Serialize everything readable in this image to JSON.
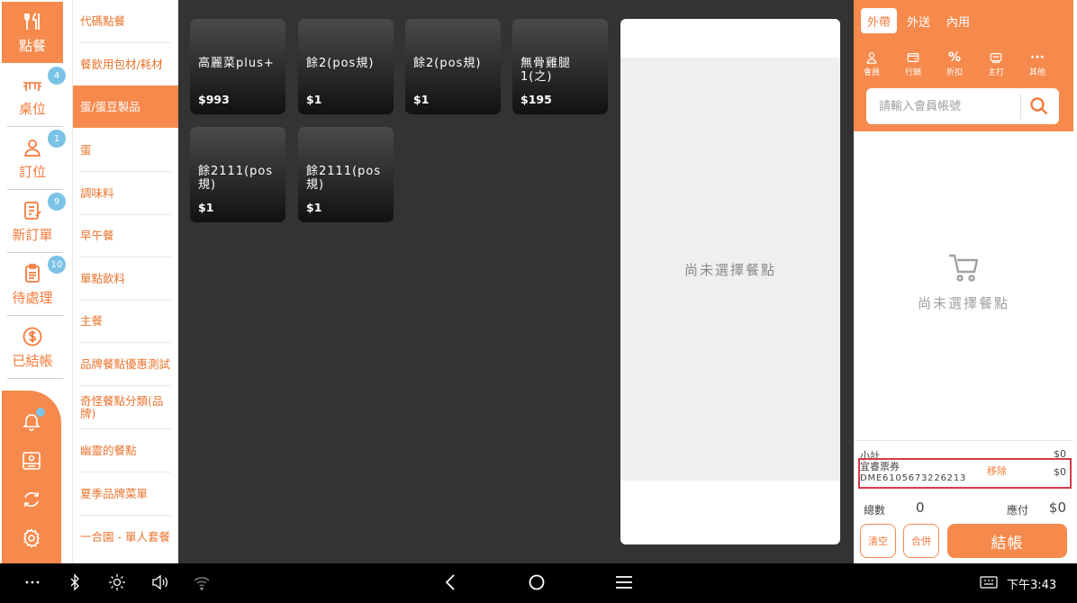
{
  "nav": {
    "items": [
      {
        "label": "點餐",
        "icon": "utensils-icon",
        "badge": ""
      },
      {
        "label": "桌位",
        "icon": "table-icon",
        "badge": "4"
      },
      {
        "label": "訂位",
        "icon": "user-icon",
        "badge": "1"
      },
      {
        "label": "新訂單",
        "icon": "edit-list-icon",
        "badge": "9"
      },
      {
        "label": "待處理",
        "icon": "clipboard-icon",
        "badge": "10"
      },
      {
        "label": "已結帳",
        "icon": "dollar-icon",
        "badge": ""
      }
    ],
    "tools": [
      "bell-icon",
      "cash-drawer-icon",
      "refresh-icon",
      "gear-icon"
    ]
  },
  "categories": [
    "代碼點餐",
    "餐飲用包材/耗材",
    "蛋/蛋豆製品",
    "蛋",
    "調味料",
    "早午餐",
    "單點飲料",
    "主餐",
    "品牌餐點優惠測試",
    "奇怪餐點分類(品牌)",
    "幽靈的餐點",
    "夏季品牌菜單",
    "一合園 - 單人套餐"
  ],
  "active_category": "蛋/蛋豆製品",
  "products": [
    {
      "name": "高麗菜plus+",
      "price": "$993"
    },
    {
      "name": "餘2(pos規)",
      "price": "$1"
    },
    {
      "name": "餘2(pos規)",
      "price": "$1"
    },
    {
      "name": "無骨雞腿1(之)",
      "price": "$195"
    },
    {
      "name": "餘2111(pos規)",
      "price": "$1"
    },
    {
      "name": "餘2111(pos規)",
      "price": "$1"
    }
  ],
  "detail_empty_text": "尚未選擇餐點",
  "cart": {
    "order_tabs": [
      "外帶",
      "外送",
      "內用"
    ],
    "active_tab": "外帶",
    "actions": [
      {
        "label": "會員",
        "icon": "member-icon"
      },
      {
        "label": "行銷",
        "icon": "wallet-icon"
      },
      {
        "label": "折扣",
        "icon": "percent-icon"
      },
      {
        "label": "主打",
        "icon": "printer-icon"
      },
      {
        "label": "其他",
        "icon": "more-icon"
      }
    ],
    "search_placeholder": "請輸入會員帳號",
    "empty_text": "尚未選擇餐點",
    "subtotal_label": "小計",
    "subtotal_value": "$0",
    "coupon_name": "宜睿票券",
    "coupon_code": "DME6105673226213",
    "coupon_remove": "移除",
    "coupon_value": "$0",
    "count_label": "總數",
    "count_value": "0",
    "due_label": "應付",
    "due_value": "$0",
    "clear_label": "清空",
    "merge_label": "合併",
    "checkout_label": "結帳"
  },
  "system_bar": {
    "time": "下午3:43"
  }
}
